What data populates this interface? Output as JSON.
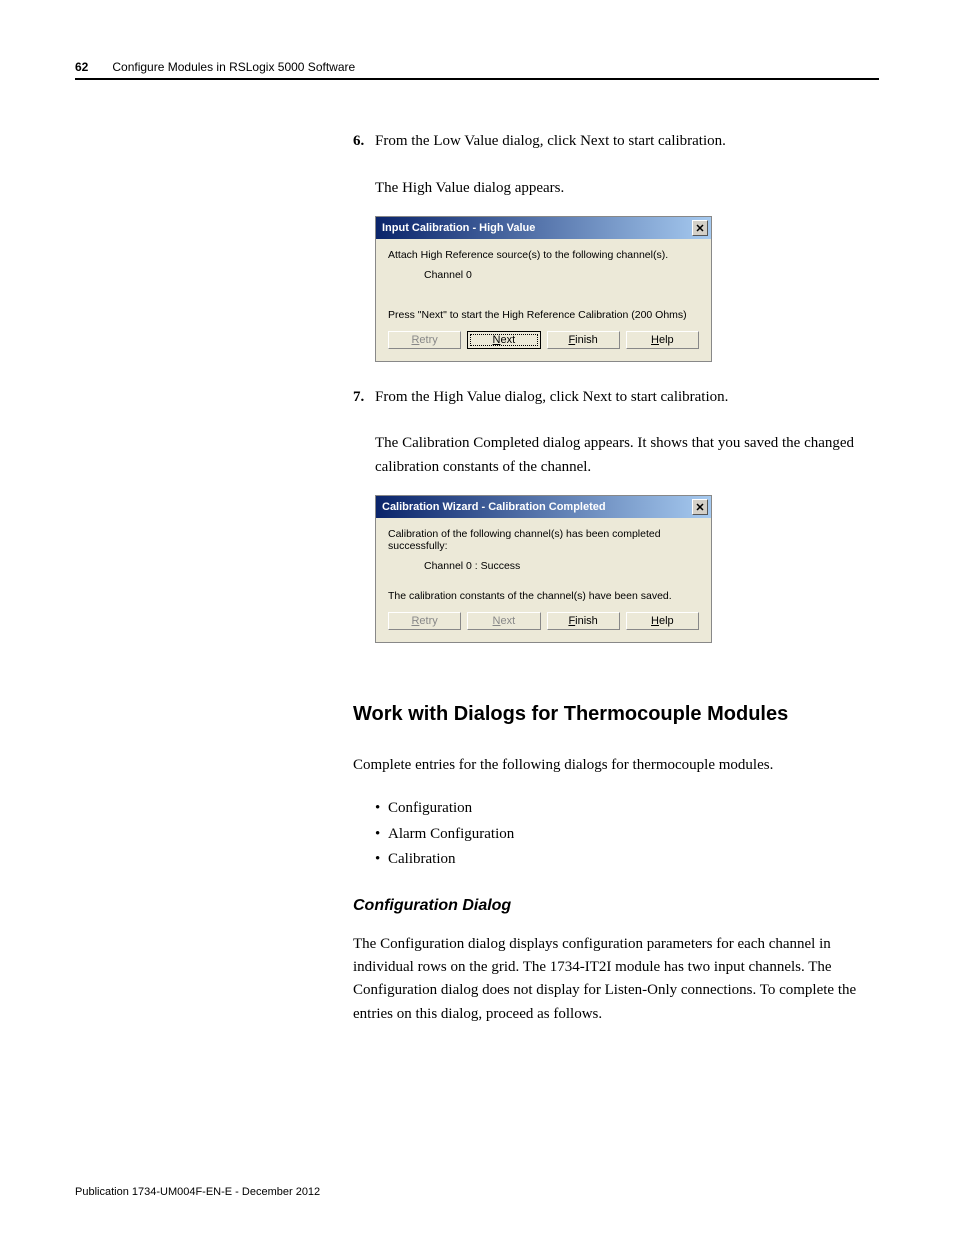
{
  "header": {
    "page_number": "62",
    "section_title": "Configure Modules in RSLogix 5000 Software"
  },
  "step6": {
    "num": "6.",
    "text": "From the Low Value dialog, click Next to start calibration.",
    "follow": "The High Value dialog appears."
  },
  "dialog1": {
    "title": "Input Calibration - High Value",
    "line1": "Attach High Reference source(s) to the following channel(s).",
    "channel": "Channel 0",
    "line2": "Press \"Next\" to start the High Reference Calibration (200 Ohms)",
    "btn_retry": "Retry",
    "btn_next_pre": "N",
    "btn_next_u": "ext",
    "btn_finish_pre": "F",
    "btn_finish_u": "inish",
    "btn_help_pre": "H",
    "btn_help_u": "elp"
  },
  "step7": {
    "num": "7.",
    "text": "From the High Value dialog, click Next to start calibration.",
    "follow": "The Calibration Completed dialog appears. It shows that you saved the changed calibration constants of the channel."
  },
  "dialog2": {
    "title": "Calibration Wizard - Calibration Completed",
    "line1": "Calibration of the following channel(s) has been completed successfully:",
    "channel": "Channel 0 : Success",
    "line2": "The calibration constants of the channel(s) have been saved.",
    "btn_retry": "Retry",
    "btn_next": "Next",
    "btn_finish_pre": "F",
    "btn_finish_u": "inish",
    "btn_help_pre": "H",
    "btn_help_u": "elp"
  },
  "section": {
    "h2": "Work with Dialogs for Thermocouple Modules",
    "intro": "Complete entries for the following dialogs for thermocouple modules.",
    "bullets": [
      "Configuration",
      "Alarm Configuration",
      "Calibration"
    ],
    "h3": "Configuration Dialog",
    "body": "The Configuration dialog displays configuration parameters for each channel in individual rows on the grid. The 1734-IT2I module has two input channels. The Configuration dialog does not display for Listen-Only connections. To complete the entries on this dialog, proceed as follows."
  },
  "footer": "Publication 1734-UM004F-EN-E - December 2012"
}
